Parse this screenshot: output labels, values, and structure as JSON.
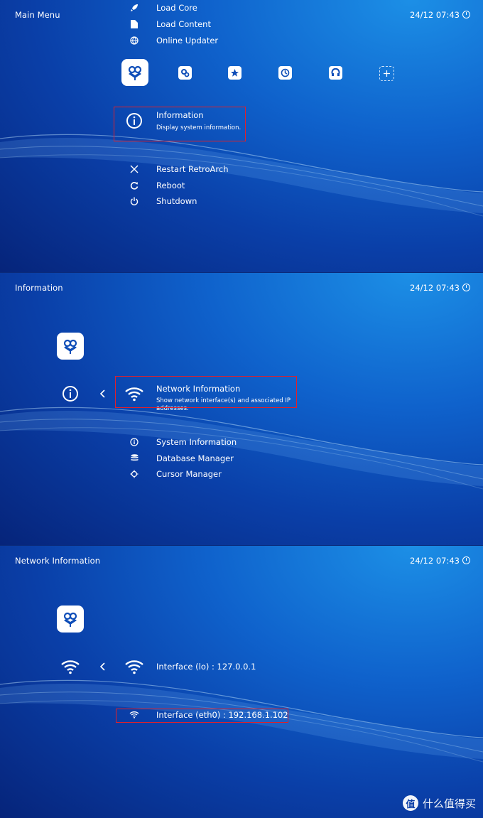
{
  "clock": "24/12 07:43",
  "colors": {
    "highlight": "#e0202a",
    "bg_top": "#1c8fe6",
    "bg_bottom": "#06247a"
  },
  "panel1": {
    "title": "Main Menu",
    "top_items": [
      {
        "label": "Load Core",
        "icon": "rocket-icon"
      },
      {
        "label": "Load Content",
        "icon": "file-icon"
      },
      {
        "label": "Online Updater",
        "icon": "globe-icon"
      }
    ],
    "tabs": [
      "main-menu-tab-icon",
      "settings-tab-icon",
      "favorites-tab-icon",
      "history-tab-icon",
      "netplay-tab-icon",
      "add-tab-icon"
    ],
    "selected": {
      "label": "Information",
      "sub": "Display system information."
    },
    "items": [
      {
        "label": "Restart RetroArch",
        "icon": "close-icon"
      },
      {
        "label": "Reboot",
        "icon": "reload-icon"
      },
      {
        "label": "Shutdown",
        "icon": "power-icon"
      }
    ]
  },
  "panel2": {
    "title": "Information",
    "selected": {
      "label": "Network Information",
      "sub_line1": "Show network interface(s) and associated IP",
      "sub_line2": "addresses."
    },
    "items": [
      {
        "label": "System Information",
        "icon": "info-icon"
      },
      {
        "label": "Database Manager",
        "icon": "database-icon"
      },
      {
        "label": "Cursor Manager",
        "icon": "cursor-icon"
      }
    ]
  },
  "panel3": {
    "title": "Network Information",
    "selected": {
      "label": "Interface (lo) : 127.0.0.1"
    },
    "items": [
      {
        "label": "Interface (eth0) : 192.168.1.102",
        "icon": "wifi-icon"
      }
    ]
  },
  "watermark": "什么值得买",
  "watermark_logo": "值"
}
